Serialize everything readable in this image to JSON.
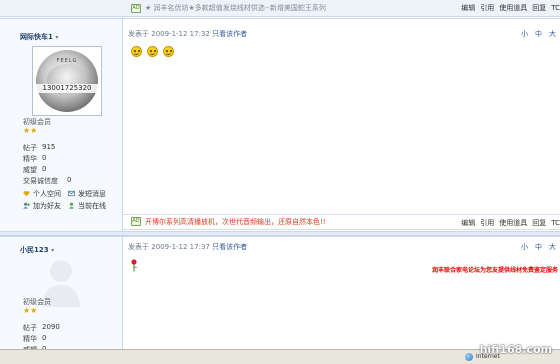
{
  "top_ad": {
    "tag": "AD",
    "text": "★ 润丰名优坊★多款超值发烧线材供选--新增美国蛇王系列"
  },
  "post_actions": [
    "编辑",
    "引用",
    "使用道具",
    "回复",
    "TC"
  ],
  "post1": {
    "username": "网际快车1",
    "caret": "▾",
    "avatar_text": "13001725320",
    "avatar_brand": "FEELG",
    "rank": "初级会员",
    "stars": "★★",
    "stats": [
      {
        "label": "帖子",
        "value": "915"
      },
      {
        "label": "精华",
        "value": "0"
      },
      {
        "label": "威望",
        "value": "0"
      },
      {
        "label": "交易诚信度",
        "value": "0"
      }
    ],
    "links": [
      "个人空间",
      "发短消息",
      "加为好友",
      "当前在线"
    ],
    "posted_label": "发表于",
    "posted_time": "2009-1-12 17:32",
    "only_author": "只看该作者",
    "font_sizes": [
      "小",
      "中",
      "大"
    ],
    "inner_ad_tag": "AD",
    "inner_ad_text": "开博尔系列高清播放机，次世代音频输出，还原自然本色!!"
  },
  "post2": {
    "username": "小民123",
    "caret": "▾",
    "rank": "初级会员",
    "stars": "★★",
    "stats": [
      {
        "label": "帖子",
        "value": "2090"
      },
      {
        "label": "精华",
        "value": "0"
      },
      {
        "label": "威望",
        "value": "0"
      }
    ],
    "posted_label": "发表于",
    "posted_time": "2009-1-12 17:37",
    "only_author": "只看该作者",
    "font_sizes": [
      "小",
      "中",
      "大"
    ],
    "signature": "润丰联合家电论坛为您友提供线材免费鉴定服务"
  },
  "status_bar": {
    "zone": "Internet"
  },
  "watermark": "hifi168.com",
  "colors": {
    "accent": "#2d5aa0",
    "ad_red": "#d63a1e",
    "note_red": "#ee0000",
    "star": "#e0a800"
  }
}
